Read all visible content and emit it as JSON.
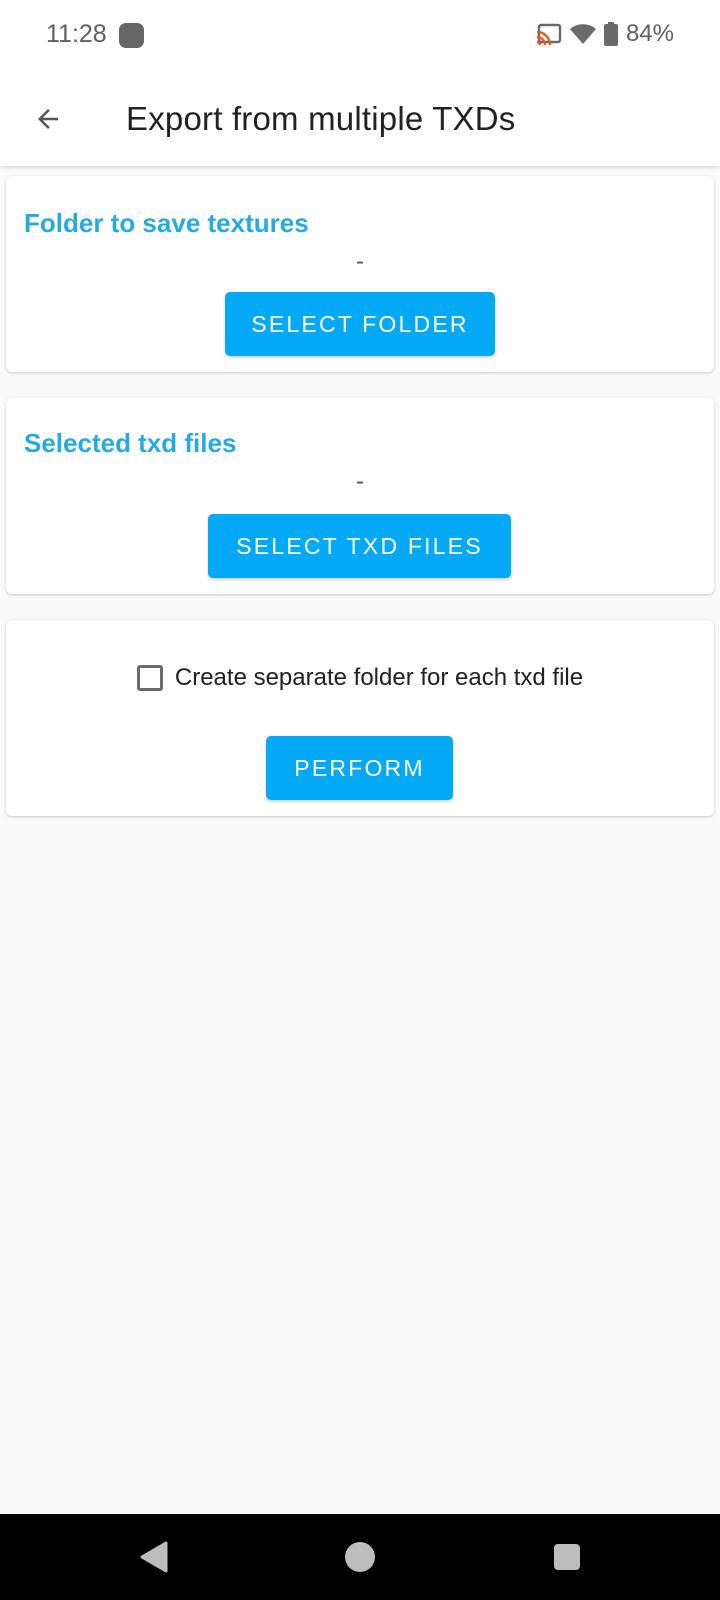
{
  "status_bar": {
    "time": "11:28",
    "battery_percent": "84%",
    "icons": [
      "app-notification-icon",
      "cast-icon",
      "wifi-icon",
      "battery-icon"
    ]
  },
  "app_bar": {
    "title": "Export from multiple TXDs",
    "back_icon": "arrow-back-icon"
  },
  "cards": {
    "folder": {
      "title": "Folder to save textures",
      "value": "-",
      "button_label": "SELECT FOLDER"
    },
    "txd_files": {
      "title": "Selected txd files",
      "value": "-",
      "button_label": "SELECT TXD FILES"
    },
    "options": {
      "checkbox_label": "Create separate folder for each txd file",
      "checkbox_checked": false,
      "button_label": "PERFORM"
    }
  },
  "nav_bar": {
    "buttons": [
      "back-triangle-icon",
      "home-circle-icon",
      "recents-square-icon"
    ]
  },
  "colors": {
    "accent": "#03a9f4",
    "title_accent": "#29a9e1",
    "nav_bg": "#000000"
  }
}
